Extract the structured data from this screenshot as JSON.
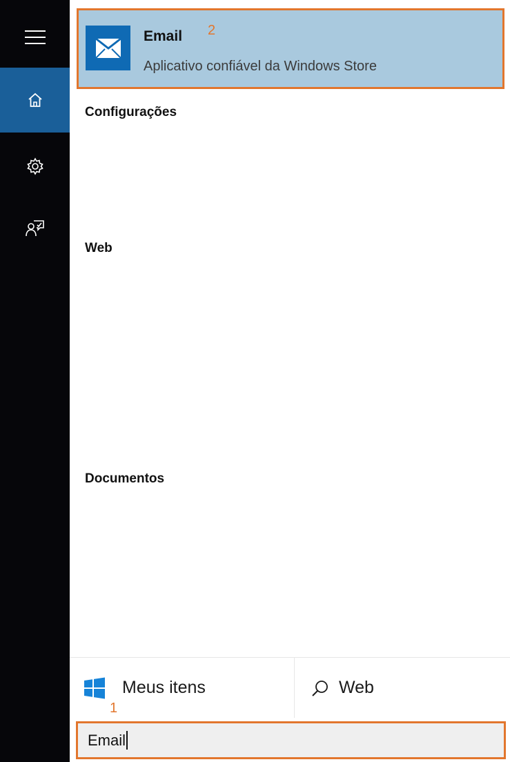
{
  "nav_rail": {
    "items": [
      {
        "id": "menu",
        "icon": "hamburger-menu-icon"
      },
      {
        "id": "home",
        "icon": "home-icon",
        "selected": true
      },
      {
        "id": "settings",
        "icon": "gear-icon"
      },
      {
        "id": "feedback",
        "icon": "feedback-icon"
      }
    ],
    "selected_color": "#1a5f99"
  },
  "top_result": {
    "title": "Email",
    "subtitle": "Aplicativo confiável da Windows Store",
    "icon": "mail-app-icon",
    "highlight_color": "#a9c9de",
    "tile_color": "#0f6ab4"
  },
  "sections": {
    "settings": "Configurações",
    "web": "Web",
    "documents": "Documentos"
  },
  "scope_bar": {
    "my_items_label": "Meus itens",
    "web_label": "Web"
  },
  "search": {
    "value": "Email"
  },
  "annotations": {
    "step_1": "1",
    "step_2": "2",
    "color": "#e2762d"
  }
}
